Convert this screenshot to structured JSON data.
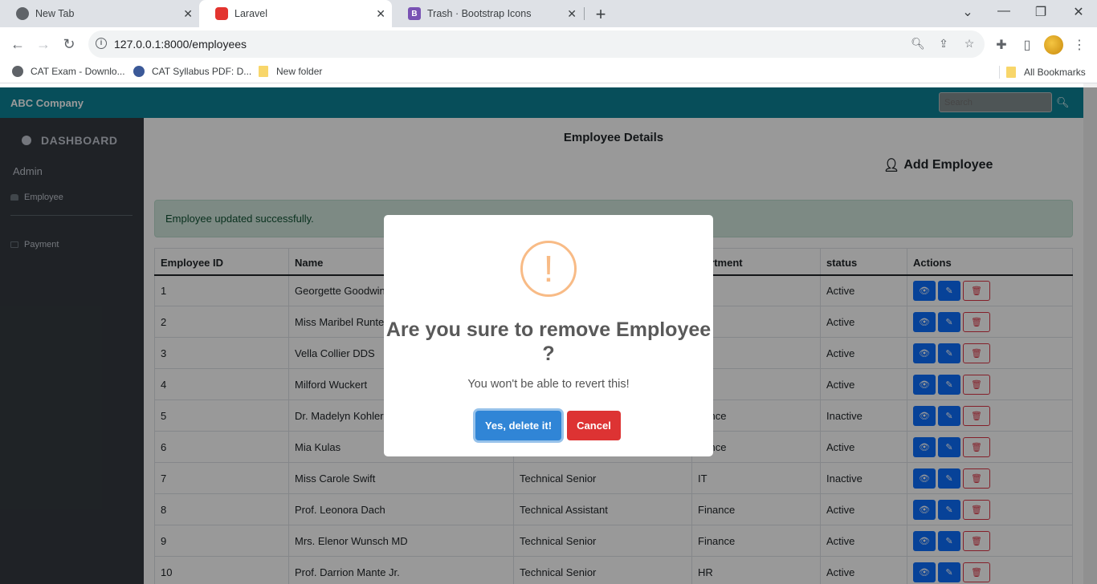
{
  "browser": {
    "tabs": [
      {
        "title": "New Tab"
      },
      {
        "title": "Laravel"
      },
      {
        "title": "Trash · Bootstrap Icons"
      }
    ],
    "url": "127.0.0.1:8000/employees",
    "bookmarks": [
      "CAT Exam - Downlo...",
      "CAT Syllabus PDF: D...",
      "New folder"
    ],
    "all_bookmarks": "All Bookmarks"
  },
  "app": {
    "brand": "ABC Company",
    "search_placeholder": "Search"
  },
  "sidebar": {
    "dashboard": "DASHBOARD",
    "admin": "Admin",
    "items": [
      {
        "label": "Employee"
      },
      {
        "label": "Payment"
      }
    ]
  },
  "main": {
    "title": "Employee Details",
    "add_button": "Add Employee",
    "alert": "Employee updated successfully."
  },
  "table": {
    "headers": [
      "Employee ID",
      "Name",
      "",
      "partment",
      "status",
      "Actions"
    ],
    "rows": [
      {
        "id": "1",
        "name": "Georgette Goodwin",
        "designation": "",
        "department": "les",
        "status": "Active"
      },
      {
        "id": "2",
        "name": "Miss Maribel Runte",
        "designation": "",
        "department": "",
        "status": "Active"
      },
      {
        "id": "3",
        "name": "Vella Collier DDS",
        "designation": "",
        "department": "",
        "status": "Active"
      },
      {
        "id": "4",
        "name": "Milford Wuckert",
        "designation": "",
        "department": "les",
        "status": "Active"
      },
      {
        "id": "5",
        "name": "Dr. Madelyn Kohler",
        "designation": "",
        "department": "nance",
        "status": "Inactive"
      },
      {
        "id": "6",
        "name": "Mia Kulas",
        "designation": "",
        "department": "nance",
        "status": "Active"
      },
      {
        "id": "7",
        "name": "Miss Carole Swift",
        "designation": "Technical Senior",
        "department": "IT",
        "status": "Inactive"
      },
      {
        "id": "8",
        "name": "Prof. Leonora Dach",
        "designation": "Technical Assistant",
        "department": "Finance",
        "status": "Active"
      },
      {
        "id": "9",
        "name": "Mrs. Elenor Wunsch MD",
        "designation": "Technical Senior",
        "department": "Finance",
        "status": "Active"
      },
      {
        "id": "10",
        "name": "Prof. Darrion Mante Jr.",
        "designation": "Technical Senior",
        "department": "HR",
        "status": "Active"
      }
    ]
  },
  "modal": {
    "icon": "!",
    "title": "Are you sure to remove Employee ?",
    "text": "You won't be able to revert this!",
    "confirm": "Yes, delete it!",
    "cancel": "Cancel"
  }
}
